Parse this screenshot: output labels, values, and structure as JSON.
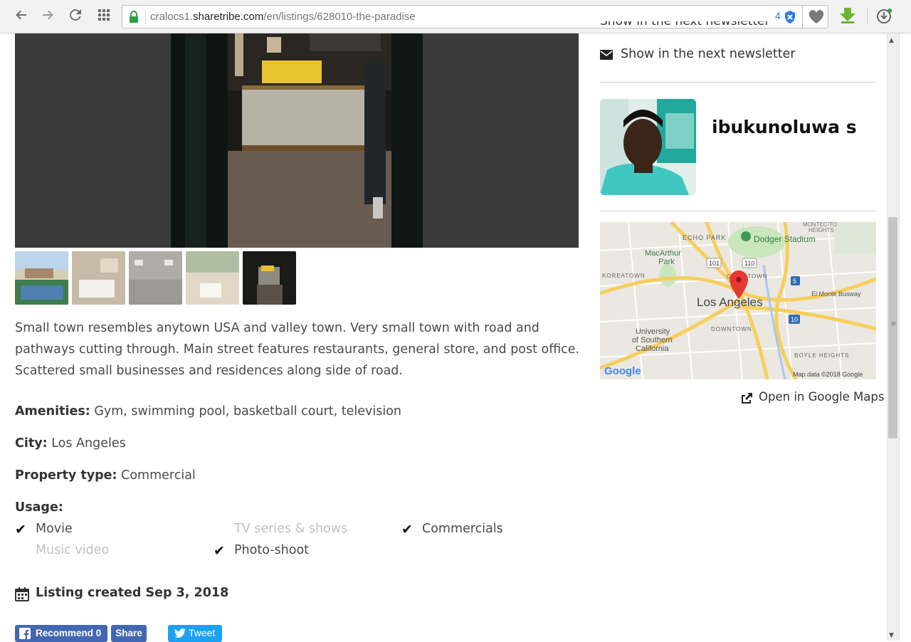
{
  "browser": {
    "url_prefix": "cralocs1.",
    "url_host": "sharetribe.com",
    "url_path": "/en/listings/628010-the-paradise",
    "badge_count": "4"
  },
  "sidebar": {
    "partial_item": "Show in the next newsletter",
    "newsletter_label": "Show in the next newsletter",
    "author_name": "ibukunoluwa s",
    "map_labels": {
      "echo_park": "ECHO PARK",
      "montecito": "MONTECITO",
      "heights": "HEIGHTS",
      "dodger": "Dodger Stadium",
      "macarthur": "MacArthur",
      "park": "Park",
      "koreatown": "KOREATOWN",
      "chinatown": "CHINATOWN",
      "la": "Los Angeles",
      "downtown": "DOWNTOWN",
      "university": "University",
      "of_southern": "of Southern",
      "california": "California",
      "boyle": "BOYLE HEIGHTS",
      "el_monte": "El Monte Busway",
      "hwy101": "101",
      "hwy110": "110",
      "hwy5": "5",
      "hwy10": "10",
      "google": "Google",
      "map_data": "Map data ©2018 Google"
    },
    "open_maps_label": "Open in Google Maps"
  },
  "listing": {
    "description": "Small town resembles anytown USA and valley town. Very small town with road and pathways cutting through. Main street features restaurants, general store, and post office. Scattered small businesses and residences along side of road.",
    "amenities_label": "Amenities:",
    "amenities_value": "Gym, swimming pool, basketball court, television",
    "city_label": "City:",
    "city_value": "Los Angeles",
    "property_label": "Property type:",
    "property_value": "Commercial",
    "usage_label": "Usage:",
    "usage": [
      {
        "label": "Movie",
        "checked": true
      },
      {
        "label": "TV series & shows",
        "checked": false
      },
      {
        "label": "Commercials",
        "checked": true
      },
      {
        "label": "Music video",
        "checked": false
      },
      {
        "label": "Photo-shoot",
        "checked": true
      }
    ],
    "created": "Listing created Sep 3, 2018"
  },
  "social": {
    "recommend": "Recommend 0",
    "share": "Share",
    "tweet": "Tweet"
  }
}
